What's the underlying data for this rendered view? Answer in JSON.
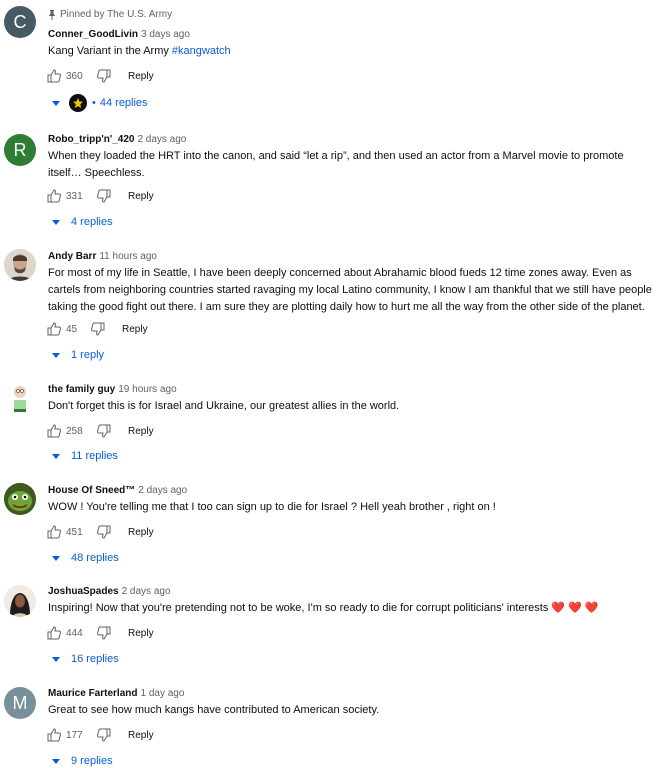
{
  "comments": [
    {
      "pinned_label": "Pinned by The U.S. Army",
      "author": "Conner_GoodLivin",
      "time": "3 days ago",
      "text": "Kang Variant in the Army ",
      "hashtag": "#kangwatch",
      "likes": "360",
      "reply_label": "Reply",
      "replies": "44 replies",
      "avatar_letter": "C",
      "avatar_color": "#455a64"
    },
    {
      "author": "Robo_tripp'n'_420",
      "time": "2 days ago",
      "text": "When they loaded the HRT into the canon, and said “let a rip”, and then used an actor from a Marvel movie to promote itself… Speechless.",
      "likes": "331",
      "reply_label": "Reply",
      "replies": "4 replies",
      "avatar_letter": "R",
      "avatar_color": "#2e7d32"
    },
    {
      "author": "Andy Barr",
      "time": "11 hours ago",
      "text": "For most of my life in Seattle, I have been deeply concerned about Abrahamic blood fueds 12 time zones away. Even as cartels from neighboring countries started ravaging my local Latino community, I know I am thankful that we still have people taking the good fight out there. I am sure they are plotting daily how to hurt me all the way from the other side of the planet.",
      "likes": "45",
      "reply_label": "Reply",
      "replies": "1 reply"
    },
    {
      "author": "the family guy",
      "time": "19 hours ago",
      "text": "Don't forget this is for Israel and Ukraine, our greatest allies in the world.",
      "likes": "258",
      "reply_label": "Reply",
      "replies": "11 replies"
    },
    {
      "author": "House Of Sneed™",
      "time": "2 days ago",
      "text": "WOW ! You're telling me that I too can sign up to die for Israel ? Hell yeah brother , right on !",
      "likes": "451",
      "reply_label": "Reply",
      "replies": "48 replies"
    },
    {
      "author": "JoshuaSpades",
      "time": "2 days ago",
      "text": "Inspiring! Now that you're pretending not to be woke, I'm so ready to die for corrupt politicians' interests ",
      "emoji": "❤️ ❤️ ❤️",
      "likes": "444",
      "reply_label": "Reply",
      "replies": "16 replies"
    },
    {
      "author": "Maurice Farterland",
      "time": "1 day ago",
      "text": "Great to see how much kangs have contributed to American society.",
      "likes": "177",
      "reply_label": "Reply",
      "replies": "9 replies",
      "avatar_letter": "M",
      "avatar_color": "#78909c"
    }
  ],
  "icons": {
    "like": "thumbs-up-outline-icon",
    "dislike": "thumbs-down-outline-icon",
    "pin": "pin-icon",
    "caret": "caret-down-icon"
  }
}
